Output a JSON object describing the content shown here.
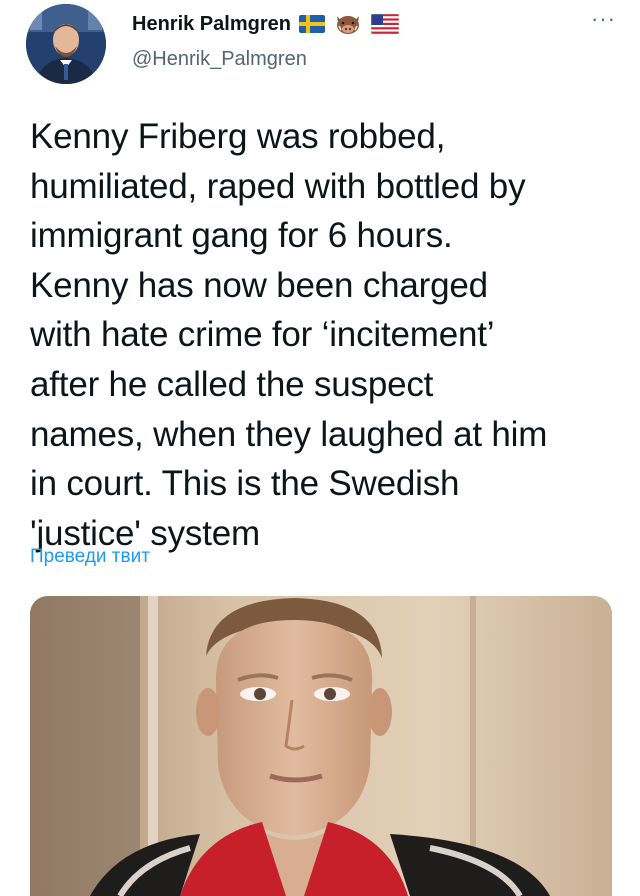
{
  "author": {
    "display_name": "Henrik Palmgren",
    "handle": "@Henrik_Palmgren",
    "avatar_icon": "profile-photo",
    "badges": [
      "sweden-flag-icon",
      "boar-icon",
      "us-flag-icon"
    ]
  },
  "menu": {
    "more_label": "···"
  },
  "tweet": {
    "text": "Kenny Friberg was robbed,\nhumiliated, raped with bottled by\nimmigrant gang for 6 hours.\nKenny has now been charged\nwith hate crime for ‘incitement’\nafter he called the suspect\nnames, when they laughed at him\nin court. This is the Swedish\n'justice' system",
    "translate_label": "Преведи твит"
  },
  "colors": {
    "text": "#0f1419",
    "secondary": "#536471",
    "link": "#1d9bf0"
  }
}
